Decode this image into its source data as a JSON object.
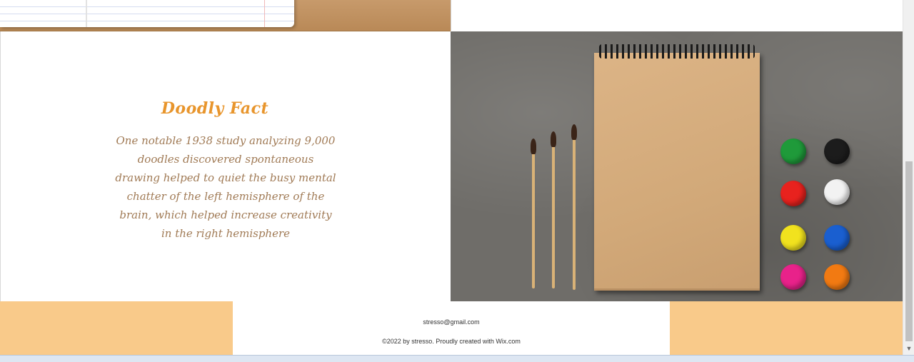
{
  "fact": {
    "title": "Doodly  Fact",
    "body": "One notable 1938 study analyzing 9,000 doodles discovered spontaneous drawing helped to quiet the busy mental chatter of the left hemisphere of the brain, which helped increase creativity in the right hemisphere"
  },
  "footer": {
    "email": "stresso@gmail.com",
    "copyright": "©2022 by stresso. Proudly created with Wix.com"
  },
  "colors": {
    "accent_orange": "#e8952c",
    "body_text": "#a07a55",
    "footer_peach": "#f9ca8a"
  },
  "icons": {
    "scroll_down": "▼"
  }
}
